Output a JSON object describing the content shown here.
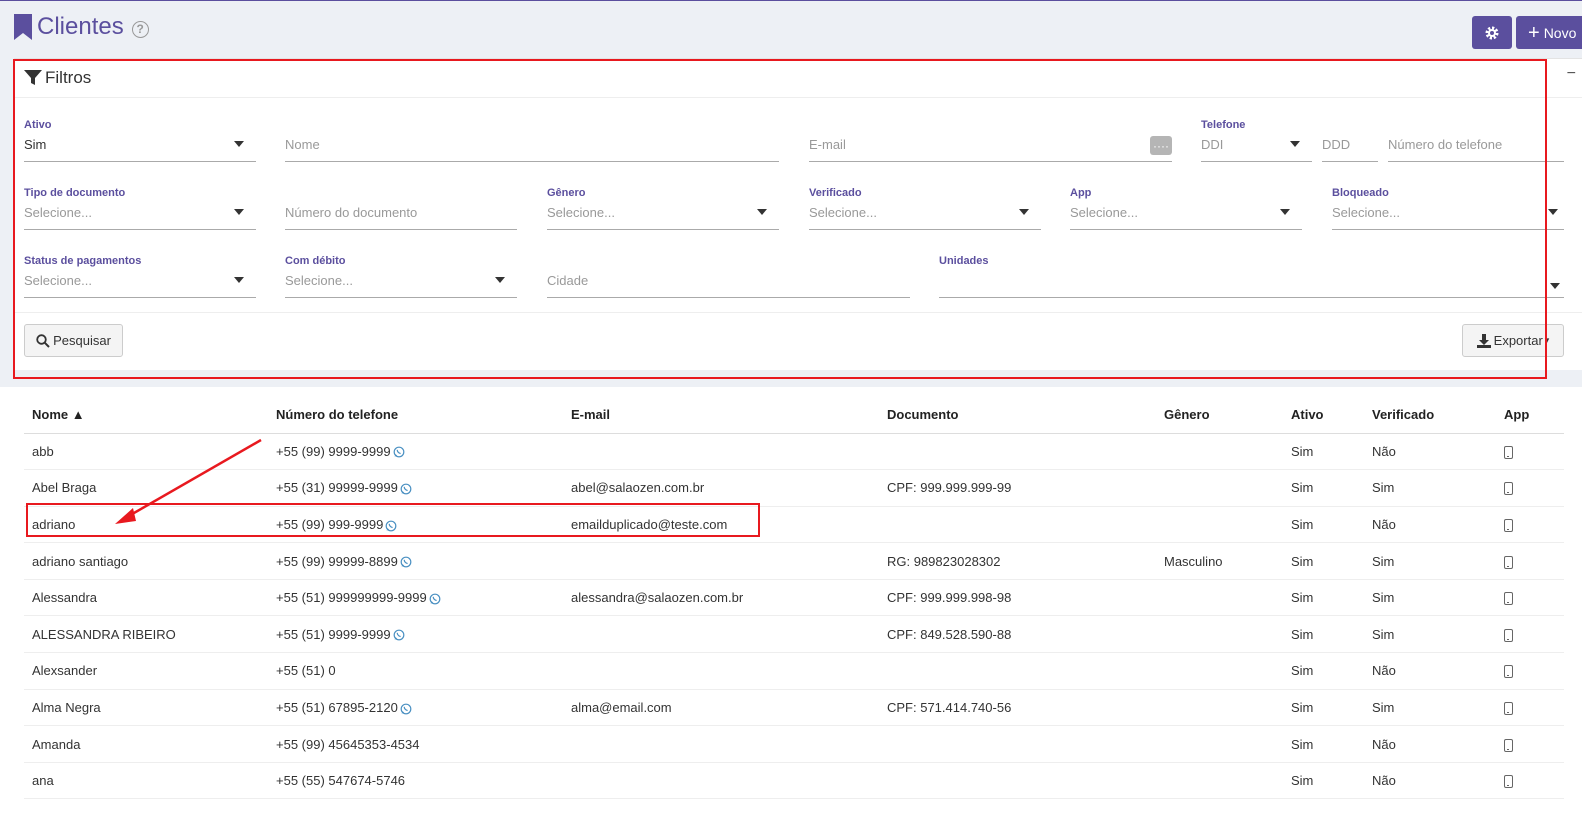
{
  "header": {
    "title": "Clientes",
    "help": "?",
    "new_label": "Novo"
  },
  "filters": {
    "title": "Filtros",
    "collapse": "−",
    "ativo": {
      "label": "Ativo",
      "value": "Sim"
    },
    "nome": {
      "placeholder": "Nome"
    },
    "email": {
      "placeholder": "E-mail",
      "dots": "····"
    },
    "telefone": {
      "label": "Telefone",
      "ddi": "DDI",
      "ddd": "DDD",
      "numero": "Número do telefone"
    },
    "tipo_documento": {
      "label": "Tipo de documento",
      "placeholder": "Selecione..."
    },
    "numero_documento": {
      "placeholder": "Número do documento"
    },
    "genero": {
      "label": "Gênero",
      "placeholder": "Selecione..."
    },
    "verificado": {
      "label": "Verificado",
      "placeholder": "Selecione..."
    },
    "app": {
      "label": "App",
      "placeholder": "Selecione..."
    },
    "bloqueado": {
      "label": "Bloqueado",
      "placeholder": "Selecione..."
    },
    "status_pagamentos": {
      "label": "Status de pagamentos",
      "placeholder": "Selecione..."
    },
    "com_debito": {
      "label": "Com débito",
      "placeholder": "Selecione..."
    },
    "cidade": {
      "placeholder": "Cidade"
    },
    "unidades": {
      "label": "Unidades"
    },
    "search_label": "Pesquisar",
    "export_label": "Exportar"
  },
  "table": {
    "columns": [
      "Nome ▲",
      "Número do telefone",
      "E-mail",
      "Documento",
      "Gênero",
      "Ativo",
      "Verificado",
      "App"
    ],
    "rows": [
      {
        "nome": "abb",
        "telefone": "+55 (99) 9999-9999",
        "whatsapp": true,
        "email": "",
        "documento": "",
        "genero": "",
        "ativo": "Sim",
        "verificado": "Não"
      },
      {
        "nome": "Abel Braga",
        "telefone": "+55 (31) 99999-9999",
        "whatsapp": true,
        "email": "abel@salaozen.com.br",
        "documento": "CPF: 999.999.999-99",
        "genero": "",
        "ativo": "Sim",
        "verificado": "Sim"
      },
      {
        "nome": "adriano",
        "telefone": "+55 (99) 999-9999",
        "whatsapp": true,
        "email": "emailduplicado@teste.com",
        "documento": "",
        "genero": "",
        "ativo": "Sim",
        "verificado": "Não"
      },
      {
        "nome": "adriano santiago",
        "telefone": "+55 (99) 99999-8899",
        "whatsapp": true,
        "email": "",
        "documento": "RG: 989823028302",
        "genero": "Masculino",
        "ativo": "Sim",
        "verificado": "Sim"
      },
      {
        "nome": "Alessandra",
        "telefone": "+55 (51) 999999999-9999",
        "whatsapp": true,
        "email": "alessandra@salaozen.com.br",
        "documento": "CPF: 999.999.998-98",
        "genero": "",
        "ativo": "Sim",
        "verificado": "Sim"
      },
      {
        "nome": "ALESSANDRA RIBEIRO",
        "telefone": "+55 (51) 9999-9999",
        "whatsapp": true,
        "email": "",
        "documento": "CPF: 849.528.590-88",
        "genero": "",
        "ativo": "Sim",
        "verificado": "Sim"
      },
      {
        "nome": "Alexsander",
        "telefone": "+55 (51) 0",
        "whatsapp": false,
        "email": "",
        "documento": "",
        "genero": "",
        "ativo": "Sim",
        "verificado": "Não"
      },
      {
        "nome": "Alma Negra",
        "telefone": "+55 (51) 67895-2120",
        "whatsapp": true,
        "email": "alma@email.com",
        "documento": "CPF: 571.414.740-56",
        "genero": "",
        "ativo": "Sim",
        "verificado": "Sim"
      },
      {
        "nome": "Amanda",
        "telefone": "+55 (99) 45645353-4534",
        "whatsapp": false,
        "email": "",
        "documento": "",
        "genero": "",
        "ativo": "Sim",
        "verificado": "Não"
      },
      {
        "nome": "ana",
        "telefone": "+55 (55) 547674-5746",
        "whatsapp": false,
        "email": "",
        "documento": "",
        "genero": "",
        "ativo": "Sim",
        "verificado": "Não"
      }
    ]
  },
  "colors": {
    "accent": "#5b4f9e",
    "highlight": "#e8191f",
    "whatsapp": "#4a90c2"
  }
}
